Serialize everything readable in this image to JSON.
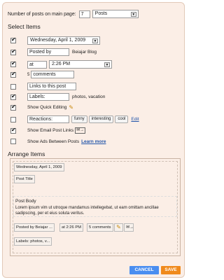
{
  "header": {
    "posts_label": "Number of posts on main page:",
    "posts_value": "7",
    "posts_unit": "Posts"
  },
  "select_items": {
    "title": "Select Items",
    "date_value": "Wednesday, April 1, 2009",
    "posted_by_prefix": "Posted by",
    "posted_by_name": "Beiajar Blog",
    "at_label": "at",
    "time_value": "2:26 PM",
    "comments_count": "5",
    "comments_label": "comments",
    "links_label": "Links to this post",
    "labels_label": "Labels:",
    "labels_value": "photos, vacation",
    "quick_edit_label": "Show Quick Editing",
    "reactions_label": "Reactions:",
    "reactions": [
      "funny",
      "interesting",
      "cool"
    ],
    "edit_link": "Edit",
    "email_links_label": "Show Email Post Links",
    "ads_label": "Show Ads Between Posts",
    "learn_more": "Learn more"
  },
  "arrange": {
    "title": "Arrange Items",
    "date_chip": "Wednesday, April 1, 2009",
    "post_title_chip": "Post Title",
    "post_body_title": "Post Body",
    "post_body_text": "Lorem ipsum vim ut utroque mandamus intellegebat, ut eam omittam ancillae sadipscing, per et eius soluta veritus.",
    "posted_by_chip": "Posted by Beiajar ...",
    "time_chip": "at 2:26 PM",
    "comments_chip": "5 comments",
    "labels_chip": "Labels: photos, v..."
  },
  "footer": {
    "cancel_label": "CANCEL",
    "save_label": "SAVE",
    "cancel_color": "#4a8ef0",
    "save_color": "#f08a1c"
  }
}
